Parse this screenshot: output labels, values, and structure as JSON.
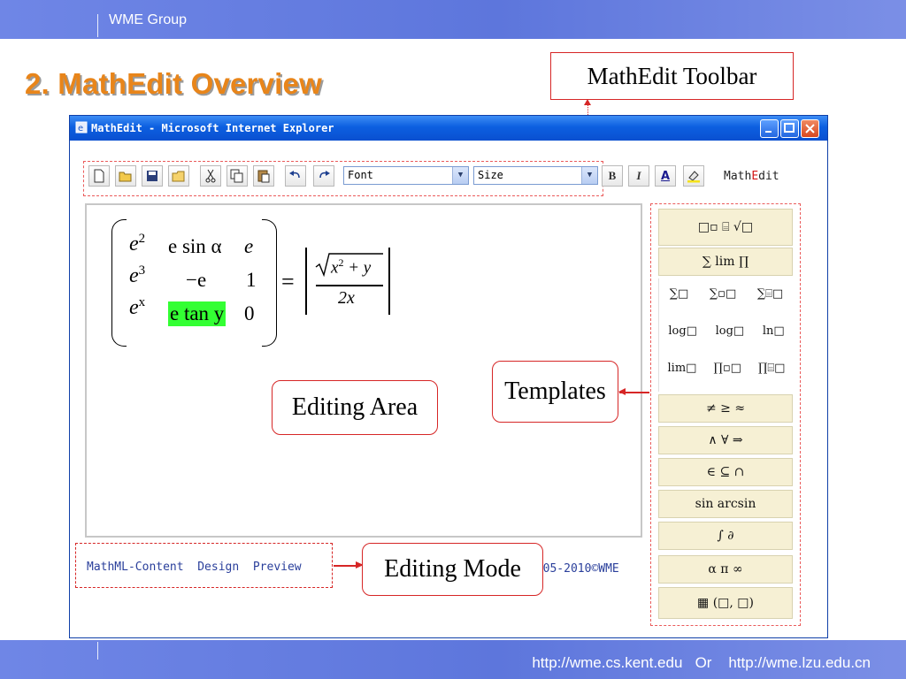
{
  "slide": {
    "group": "WME  Group",
    "title": "2. MathEdit Overview",
    "footer_links": "http://wme.cs.kent.edu   Or    http://wme.lzu.edu.cn"
  },
  "callouts": {
    "toolbar": "MathEdit Toolbar",
    "templates": "Templates",
    "editing_area": "Editing Area",
    "editing_mode": "Editing Mode"
  },
  "window": {
    "title": "MathEdit - Microsoft Internet Explorer",
    "colors": {
      "titlebar": "#0c5fe0",
      "close": "#d8471f"
    }
  },
  "toolbar": {
    "font_value": "Font",
    "size_value": "Size",
    "brand_prefix": "Math",
    "brand_red": "E",
    "brand_suffix": "dit",
    "bold": "B",
    "italic": "I",
    "font_color": "A",
    "icons": [
      "new-icon",
      "open-icon",
      "save-icon",
      "folder-icon",
      "cut-icon",
      "copy-icon",
      "paste-icon",
      "undo-icon",
      "redo-icon",
      "highlight-icon"
    ]
  },
  "expression": {
    "m11_base": "e",
    "m11_exp": "2",
    "m12": "e sin α",
    "m13": "e",
    "m21_base": "e",
    "m21_exp": "3",
    "m22": "−e",
    "m23": "1",
    "m31_base": "e",
    "m31_exp": "x",
    "m32": "e tan y",
    "m33": "0",
    "equals": "=",
    "num_var": "x",
    "num_exp": "2",
    "num_rest": "+ y",
    "den": "2x",
    "highlight_color": "#33ff33"
  },
  "templates": {
    "rows": [
      "□▫  ⌸  √□",
      "∑  lim  ∏",
      "≠  ≥  ≈",
      "∧  ∀  ⇒",
      "∈  ⊆  ∩",
      "sin  arcsin",
      "∫  ∂",
      "α  π  ∞",
      "▦  (□, □)"
    ],
    "submenu": [
      [
        "∑□",
        "∑▫□",
        "∑⌸□"
      ],
      [
        "log□",
        "log□",
        "ln□"
      ],
      [
        "lim□",
        "∏▫□",
        "∏⌸□"
      ]
    ]
  },
  "footer": {
    "mode": "MathML-Content  Design  Preview",
    "copyright": "2005-2010©WME"
  }
}
